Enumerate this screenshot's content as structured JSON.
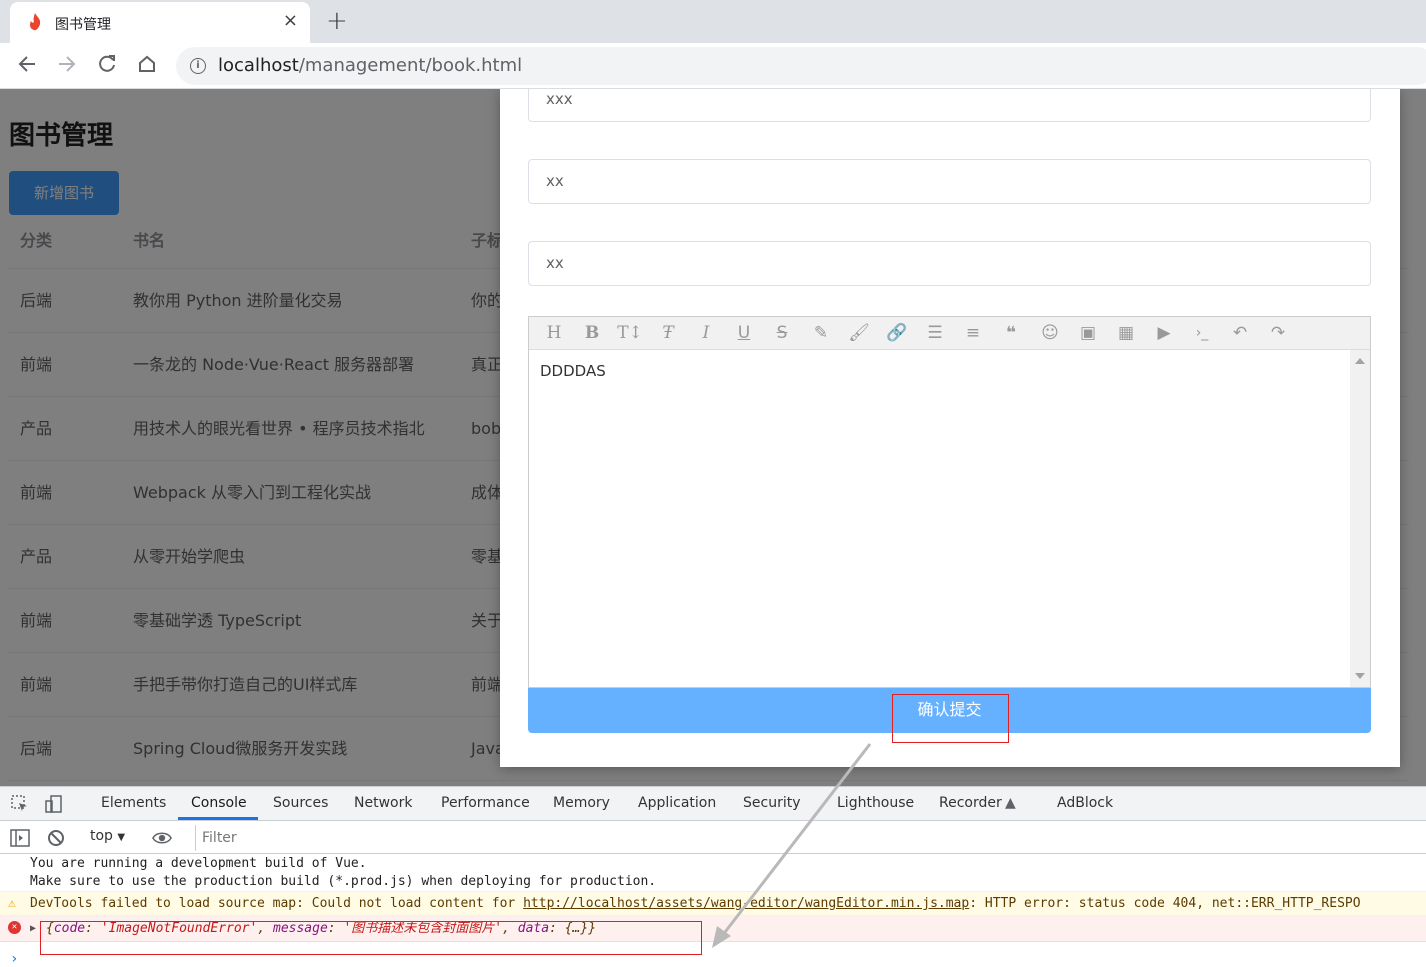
{
  "browser": {
    "tab_title": "图书管理",
    "tab_close": "×",
    "new_tab": "+",
    "url_host": "localhost",
    "url_path": "/management/book.html"
  },
  "page": {
    "heading": "图书管理",
    "add_button": "新增图书",
    "table": {
      "headers": [
        "分类",
        "书名",
        "子标"
      ],
      "rows": [
        [
          "后端",
          "教你用 Python 进阶量化交易",
          "你的"
        ],
        [
          "前端",
          "一条龙的 Node·Vue·React 服务器部署",
          "真正"
        ],
        [
          "产品",
          "用技术人的眼光看世界 • 程序员技术指北",
          "bob"
        ],
        [
          "前端",
          "Webpack 从零入门到工程化实战",
          "成体"
        ],
        [
          "产品",
          "从零开始学爬虫",
          "零基"
        ],
        [
          "前端",
          "零基础学透 TypeScript",
          "关于"
        ],
        [
          "前端",
          "手把手带你打造自己的UI样式库",
          "前端"
        ],
        [
          "后端",
          "Spring Cloud微服务开发实践",
          "Java"
        ]
      ]
    }
  },
  "dialog": {
    "fields": [
      "xxx",
      "xx",
      "xx"
    ],
    "editor_toolbar": [
      "H",
      "B",
      "TI",
      "F",
      "I",
      "U",
      "S",
      "pen",
      "brush",
      "link",
      "list",
      "align",
      "quote",
      "emoji",
      "image",
      "table",
      "video",
      "code",
      "undo",
      "redo"
    ],
    "editor_content": "DDDDAS",
    "submit_label": "确认提交"
  },
  "devtools": {
    "tabs": [
      "Elements",
      "Console",
      "Sources",
      "Network",
      "Performance",
      "Memory",
      "Application",
      "Security",
      "Lighthouse",
      "Recorder",
      "AdBlock"
    ],
    "active_tab": "Console",
    "context": "top",
    "filter_placeholder": "Filter",
    "log_line_1": "You are running a development build of Vue.",
    "log_line_2": "Make sure to use the production build (*.prod.js) when deploying for production.",
    "warning_prefix": "DevTools failed to load source map: Could not load content for ",
    "warning_link": "http://localhost/assets/wang-editor/wangEditor.min.js.map",
    "warning_suffix": ": HTTP error: status code 404, net::ERR_HTTP_RESPO",
    "error_open": "{",
    "error_code_key": "code",
    "error_code_value": "'ImageNotFoundError'",
    "error_msg_key": "message",
    "error_msg_value": "'图书描述未包含封面图片'",
    "error_data_key": "data",
    "error_data_value": "{…}}",
    "prompt": "›"
  },
  "colors": {
    "primary": "#409eff",
    "submit": "#66b1ff",
    "annotation": "#e02020",
    "devtools_active": "#1a73e8"
  }
}
